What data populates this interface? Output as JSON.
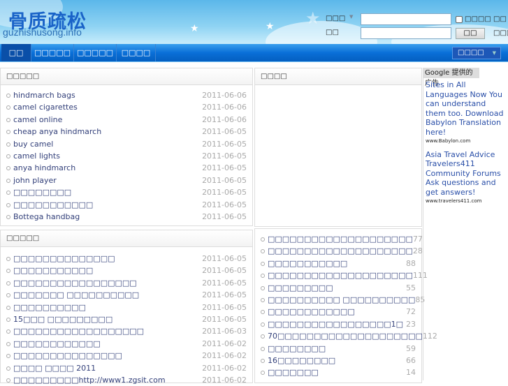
{
  "header": {
    "logo_cn": "骨质疏松",
    "logo_en": "guzhishusong.info",
    "search_type_label": "□□□",
    "keyword_label": "□□",
    "checkbox_label": "□□□□",
    "search_button": "□□",
    "link1": "□□",
    "link2": "□□□□"
  },
  "nav": {
    "items": [
      "□□",
      "□□□□□",
      "□□□□□",
      "□□□□"
    ],
    "select": "□□□□"
  },
  "latest": {
    "title": "□□□□□",
    "items": [
      {
        "t": "hindmarch bags",
        "d": "2011-06-06"
      },
      {
        "t": "camel cigarettes",
        "d": "2011-06-06"
      },
      {
        "t": "camel online",
        "d": "2011-06-06"
      },
      {
        "t": "cheap anya hindmarch",
        "d": "2011-06-05"
      },
      {
        "t": "buy camel",
        "d": "2011-06-05"
      },
      {
        "t": "camel lights",
        "d": "2011-06-05"
      },
      {
        "t": "anya hindmarch",
        "d": "2011-06-05"
      },
      {
        "t": "john player",
        "d": "2011-06-05"
      },
      {
        "t": "□□□□□□□□",
        "d": "2011-06-05"
      },
      {
        "t": "□□□□□□□□□□□",
        "d": "2011-06-05"
      },
      {
        "t": "Bottega handbag",
        "d": "2011-06-05"
      }
    ]
  },
  "second": {
    "title": "□□□□□",
    "items": [
      {
        "t": "□□□□□□□□□□□□□□",
        "d": "2011-06-05"
      },
      {
        "t": "□□□□□□□□□□□",
        "d": "2011-06-05"
      },
      {
        "t": "□□□□□□□□□□□□□□□□□",
        "d": "2011-06-05"
      },
      {
        "t": "□□□□□□□ □□□□□□□□□□",
        "d": "2011-06-05"
      },
      {
        "t": "□□□□□□□□□□",
        "d": "2011-06-05"
      },
      {
        "t": "15□□□ □□□□□□□□□",
        "d": "2011-06-05"
      },
      {
        "t": "□□□□□□□□□□□□□□□□□□",
        "d": "2011-06-03"
      },
      {
        "t": "□□□□□□□□□□□□",
        "d": "2011-06-02"
      },
      {
        "t": "□□□□□□□□□□□□□□□",
        "d": "2011-06-02"
      },
      {
        "t": "□□□□ □□□□ 2011",
        "d": "2011-06-02"
      },
      {
        "t": "□□□□□□□□□http://www1.zgsit.com",
        "d": "2011-06-02"
      }
    ]
  },
  "middle": {
    "title": "□□□□",
    "items": [
      {
        "t": "□□□□□□□□□□□□□□□□□□□□",
        "d": "77"
      },
      {
        "t": "□□□□□□□□□□□□□□□□□□□□",
        "d": "28"
      },
      {
        "t": "□□□□□□□□□□□",
        "d": "88"
      },
      {
        "t": "□□□□□□□□□□□□□□□□□□□□",
        "d": "111"
      },
      {
        "t": "□□□□□□□□□",
        "d": "55"
      },
      {
        "t": "□□□□□□□□□□ □□□□□□□□□□",
        "d": "85"
      },
      {
        "t": "□□□□□□□□□□□□",
        "d": "72"
      },
      {
        "t": "□□□□□□□□□□□□□□□□□1□",
        "d": "23"
      },
      {
        "t": "70□□□□□□□□□□□□□□□□□□□□",
        "d": "112"
      },
      {
        "t": "□□□□□□□□",
        "d": "59"
      },
      {
        "t": "16□□□□□□□□",
        "d": "66"
      },
      {
        "t": "□□□□□□□",
        "d": "14"
      }
    ]
  },
  "ads": {
    "label": "Google 提供的广告",
    "items": [
      {
        "text": "Sites in All Languages Now You can understand them too. Download Babylon Translation here!",
        "url": "www.Babylon.com"
      },
      {
        "text": "Asia Travel Advice Travelers411 Community Forums Ask questions and get answers!",
        "url": "www.travelers411.com"
      }
    ]
  }
}
